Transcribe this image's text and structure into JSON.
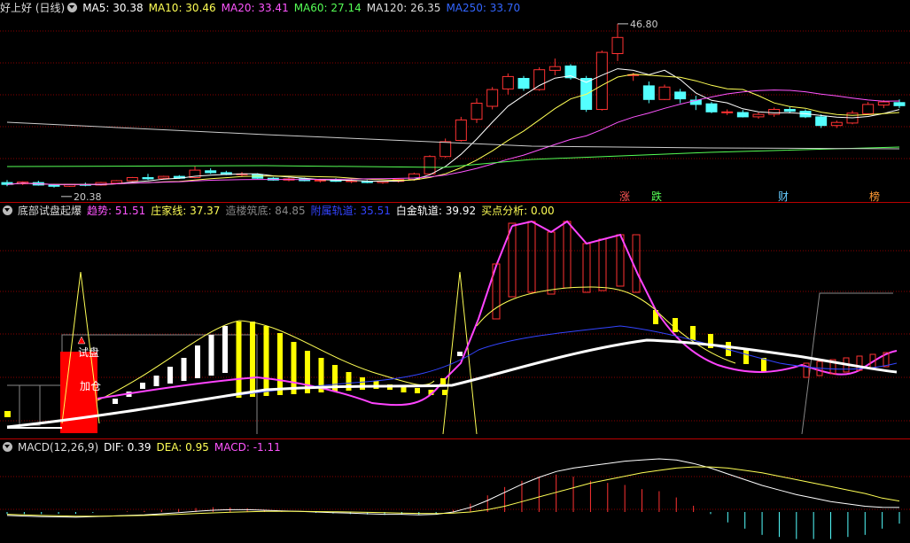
{
  "main": {
    "title": "好上好 (日线)",
    "ma": [
      {
        "label": "MA5: 30.38",
        "color": "#ffffff"
      },
      {
        "label": "MA10: 30.46",
        "color": "#ffff55"
      },
      {
        "label": "MA20: 33.41",
        "color": "#ff55ff"
      },
      {
        "label": "MA60: 27.14",
        "color": "#55ff55"
      },
      {
        "label": "MA120: 26.35",
        "color": "#dddddd"
      },
      {
        "label": "MA250: 33.70",
        "color": "#3366ff"
      }
    ],
    "high_label": "46.80",
    "low_label": "20.38",
    "badges": [
      {
        "text": "涨",
        "color": "#ff5555"
      },
      {
        "text": "跌",
        "color": "#55ff55"
      },
      {
        "text": "财",
        "color": "#66ccff"
      },
      {
        "text": "榜",
        "color": "#ff9933"
      }
    ]
  },
  "indicator": {
    "title": "底部试盘起爆",
    "items": [
      {
        "label": "趋势: 51.51",
        "color": "#ff55ff"
      },
      {
        "label": "庄家线: 37.37",
        "color": "#ffff55"
      },
      {
        "label": "造楼筑底: 84.85",
        "color": "#888888"
      },
      {
        "label": "附属轨道: 35.51",
        "color": "#3344ff"
      },
      {
        "label": "白金轨道: 39.92",
        "color": "#ffffff"
      },
      {
        "label": "买点分析: 0.00",
        "color": "#ffff55"
      }
    ],
    "annotations": [
      "试盘",
      "加仓"
    ]
  },
  "macd": {
    "title": "MACD(12,26,9)",
    "items": [
      {
        "label": "DIF: 0.39",
        "color": "#ffffff"
      },
      {
        "label": "DEA: 0.95",
        "color": "#ffff55"
      },
      {
        "label": "MACD: -1.11",
        "color": "#ff55ff"
      }
    ]
  },
  "chart_data": [
    {
      "type": "candlestick",
      "title": "好上好 (日线)",
      "series": [
        {
          "name": "MA5",
          "last": 30.38
        },
        {
          "name": "MA10",
          "last": 30.46
        },
        {
          "name": "MA20",
          "last": 33.41
        },
        {
          "name": "MA60",
          "last": 27.14
        },
        {
          "name": "MA120",
          "last": 26.35
        },
        {
          "name": "MA250",
          "last": 33.7
        }
      ],
      "ohlc": [
        [
          21.2,
          21.6,
          20.6,
          20.9
        ],
        [
          21.0,
          21.4,
          20.8,
          21.3
        ],
        [
          21.2,
          21.5,
          20.7,
          20.8
        ],
        [
          20.8,
          21.0,
          20.4,
          20.6
        ],
        [
          20.6,
          21.0,
          20.5,
          20.9
        ],
        [
          20.9,
          21.2,
          20.6,
          20.8
        ],
        [
          20.8,
          21.3,
          20.7,
          21.2
        ],
        [
          21.1,
          21.6,
          21.0,
          21.5
        ],
        [
          21.5,
          22.1,
          21.4,
          22.0
        ],
        [
          22.0,
          22.6,
          21.6,
          21.8
        ],
        [
          21.9,
          22.3,
          21.7,
          22.2
        ],
        [
          22.2,
          22.4,
          21.8,
          21.9
        ],
        [
          22.0,
          23.8,
          21.9,
          23.2
        ],
        [
          23.1,
          23.5,
          22.6,
          22.8
        ],
        [
          22.8,
          23.1,
          22.4,
          22.5
        ],
        [
          22.5,
          22.9,
          22.2,
          22.6
        ],
        [
          22.5,
          22.7,
          21.8,
          21.9
        ],
        [
          21.9,
          22.1,
          21.5,
          21.6
        ],
        [
          21.6,
          22.0,
          21.4,
          21.8
        ],
        [
          21.8,
          22.0,
          21.4,
          21.5
        ],
        [
          21.5,
          21.8,
          21.2,
          21.6
        ],
        [
          21.6,
          21.9,
          21.3,
          21.4
        ],
        [
          21.4,
          21.7,
          21.1,
          21.5
        ],
        [
          21.4,
          21.6,
          21.1,
          21.2
        ],
        [
          21.2,
          21.5,
          21.0,
          21.4
        ],
        [
          21.4,
          21.8,
          21.2,
          21.7
        ],
        [
          21.7,
          22.8,
          21.5,
          22.6
        ],
        [
          22.6,
          25.6,
          22.4,
          25.4
        ],
        [
          25.4,
          28.3,
          25.2,
          27.8
        ],
        [
          28.0,
          31.8,
          27.8,
          31.3
        ],
        [
          31.4,
          34.8,
          30.8,
          34.0
        ],
        [
          33.5,
          36.6,
          33.0,
          36.2
        ],
        [
          36.3,
          38.8,
          35.4,
          38.3
        ],
        [
          38.0,
          38.4,
          36.0,
          36.4
        ],
        [
          36.2,
          39.8,
          36.0,
          39.4
        ],
        [
          39.3,
          41.2,
          38.5,
          39.9
        ],
        [
          40.0,
          40.3,
          37.8,
          38.1
        ],
        [
          38.0,
          38.4,
          32.6,
          33.0
        ],
        [
          33.0,
          42.5,
          32.8,
          42.2
        ],
        [
          42.0,
          46.8,
          40.8,
          44.6
        ],
        [
          38.5,
          38.9,
          37.6,
          38.6
        ],
        [
          36.8,
          37.5,
          34.0,
          34.6
        ],
        [
          34.6,
          37.0,
          34.5,
          36.6
        ],
        [
          35.8,
          36.3,
          34.0,
          34.7
        ],
        [
          34.5,
          35.2,
          32.9,
          33.8
        ],
        [
          33.9,
          34.2,
          32.4,
          32.6
        ],
        [
          32.6,
          33.0,
          32.1,
          32.6
        ],
        [
          32.5,
          32.9,
          31.7,
          31.8
        ],
        [
          31.8,
          32.5,
          31.5,
          32.2
        ],
        [
          32.2,
          33.3,
          31.8,
          33.0
        ],
        [
          33.0,
          33.4,
          32.4,
          32.7
        ],
        [
          32.7,
          33.0,
          31.6,
          31.8
        ],
        [
          31.8,
          32.2,
          30.0,
          30.4
        ],
        [
          30.4,
          31.2,
          30.0,
          30.9
        ],
        [
          30.8,
          32.8,
          30.6,
          32.4
        ],
        [
          32.3,
          34.2,
          32.1,
          33.8
        ],
        [
          33.7,
          34.5,
          33.2,
          34.2
        ],
        [
          34.1,
          34.6,
          33.2,
          33.6
        ]
      ],
      "high_label": 46.8,
      "low_label": 20.38
    },
    {
      "type": "line",
      "title": "底部试盘起爆",
      "series": [
        {
          "name": "趋势",
          "last": 51.51
        },
        {
          "name": "庄家线",
          "last": 37.37
        },
        {
          "name": "造楼筑底",
          "last": 84.85
        },
        {
          "name": "附属轨道",
          "last": 35.51
        },
        {
          "name": "白金轨道",
          "last": 39.92
        },
        {
          "name": "买点分析",
          "last": 0.0
        }
      ],
      "trend": [
        16,
        16,
        16,
        16,
        17,
        18,
        22,
        25,
        28,
        32,
        36,
        40,
        44,
        50,
        58,
        64,
        64,
        63,
        58,
        52,
        46,
        41,
        36,
        32,
        28,
        27,
        26,
        27,
        25,
        25,
        24,
        23,
        22,
        21,
        22,
        24,
        28,
        45,
        65,
        92,
        99,
        98,
        96,
        97,
        95,
        97,
        98,
        99,
        92,
        74,
        60,
        54,
        47,
        44,
        42,
        41,
        40,
        42,
        42,
        41,
        40,
        39,
        38,
        40,
        43,
        46,
        49
      ],
      "zhuangjia": [
        18,
        18,
        20,
        22,
        24,
        26,
        28,
        30,
        33,
        35,
        37,
        38,
        38,
        37,
        36,
        34,
        33,
        32,
        31,
        30,
        29,
        28,
        28,
        27,
        27,
        26,
        27,
        32,
        55,
        70,
        75,
        76,
        78,
        80,
        80,
        79,
        77,
        71,
        63,
        57,
        51,
        46,
        41,
        38,
        35,
        33,
        32,
        32,
        32,
        33,
        35,
        35,
        36,
        37
      ]
    },
    {
      "type": "bar",
      "title": "MACD(12,26,9)",
      "series": [
        {
          "name": "DIF",
          "last": 0.39
        },
        {
          "name": "DEA",
          "last": 0.95
        },
        {
          "name": "MACD",
          "last": -1.11
        }
      ],
      "dif": [
        -0.3,
        -0.35,
        -0.4,
        -0.42,
        -0.45,
        -0.4,
        -0.35,
        -0.3,
        -0.25,
        -0.15,
        -0.05,
        0.05,
        0.15,
        0.2,
        0.2,
        0.15,
        0.1,
        0.05,
        0.0,
        -0.05,
        -0.1,
        -0.15,
        -0.2,
        -0.2,
        -0.25,
        -0.2,
        0.0,
        0.4,
        1.0,
        1.7,
        2.4,
        3.0,
        3.5,
        3.8,
        4.0,
        4.2,
        4.4,
        4.5,
        4.6,
        4.5,
        4.2,
        3.8,
        3.3,
        2.8,
        2.3,
        1.9,
        1.5,
        1.2,
        0.9,
        0.7,
        0.5,
        0.4,
        0.39
      ],
      "dea": [
        -0.2,
        -0.25,
        -0.3,
        -0.33,
        -0.36,
        -0.36,
        -0.35,
        -0.33,
        -0.3,
        -0.25,
        -0.2,
        -0.14,
        -0.08,
        -0.02,
        0.02,
        0.05,
        0.06,
        0.05,
        0.04,
        0.02,
        0.0,
        -0.03,
        -0.06,
        -0.09,
        -0.12,
        -0.13,
        -0.1,
        0.0,
        0.2,
        0.5,
        0.9,
        1.3,
        1.7,
        2.1,
        2.5,
        2.8,
        3.1,
        3.4,
        3.6,
        3.8,
        3.9,
        3.9,
        3.8,
        3.6,
        3.4,
        3.1,
        2.8,
        2.5,
        2.2,
        1.9,
        1.6,
        1.2,
        0.95
      ]
    }
  ]
}
